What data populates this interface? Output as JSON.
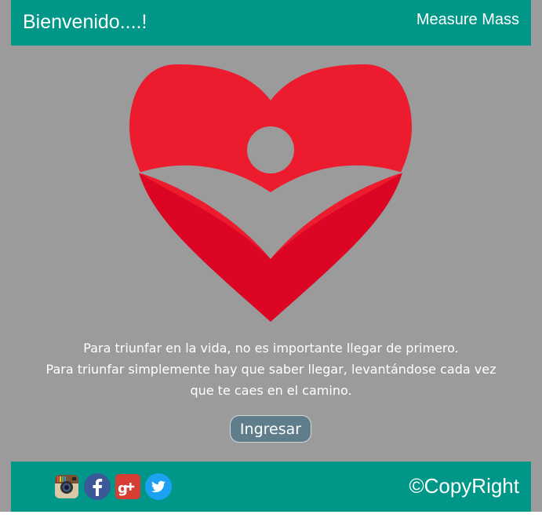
{
  "header": {
    "welcome": "Bienvenido....!",
    "brand": "Measure Mass"
  },
  "logo": {
    "icon": "heart-person-logo-icon",
    "colors": {
      "top": "#ec1c2e",
      "bottom": "#dc0624",
      "cutout": "#9b9b9b"
    }
  },
  "quote": {
    "line1": "Para triunfar en la vida, no es importante llegar de primero.",
    "line2": "Para triunfar simplemente hay que saber llegar, levantándose cada vez",
    "line3": "que te caes en el camino."
  },
  "actions": {
    "enter_label": "Ingresar"
  },
  "footer": {
    "social": [
      {
        "name": "instagram",
        "icon": "instagram-icon"
      },
      {
        "name": "facebook",
        "icon": "facebook-icon"
      },
      {
        "name": "google-plus",
        "icon": "google-plus-icon"
      },
      {
        "name": "twitter",
        "icon": "twitter-icon"
      }
    ],
    "copyright": "©CopyRight"
  },
  "colors": {
    "accent": "#009688",
    "background": "#9b9b9b",
    "button": "#607d8b"
  }
}
